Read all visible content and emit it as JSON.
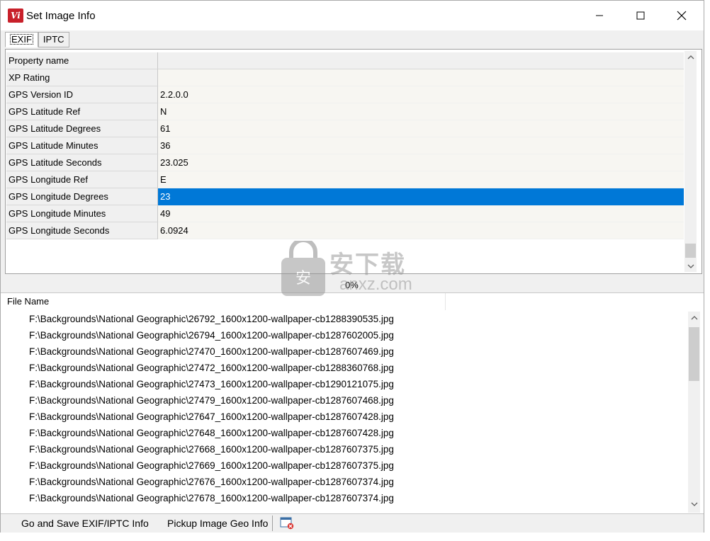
{
  "window": {
    "title": "Set Image Info",
    "app_icon_text": "Vi"
  },
  "tabs": [
    {
      "label": "EXIF",
      "active": true
    },
    {
      "label": "IPTC",
      "active": false
    }
  ],
  "grid": {
    "header": {
      "name": "Property name",
      "value": ""
    },
    "rows": [
      {
        "name": "XP Rating",
        "value": ""
      },
      {
        "name": "GPS Version ID",
        "value": "2.2.0.0"
      },
      {
        "name": "GPS Latitude Ref",
        "value": "N"
      },
      {
        "name": "GPS Latitude Degrees",
        "value": "61"
      },
      {
        "name": "GPS Latitude Minutes",
        "value": "36"
      },
      {
        "name": "GPS Latitude Seconds",
        "value": "23.025"
      },
      {
        "name": "GPS Longitude Ref",
        "value": "E"
      },
      {
        "name": "GPS Longitude Degrees",
        "value": "23"
      },
      {
        "name": "GPS Longitude Minutes",
        "value": "49"
      },
      {
        "name": "GPS Longitude Seconds",
        "value": "6.0924"
      }
    ],
    "selected_row": "GPS Longitude Degrees",
    "selection_color": "#0078d7"
  },
  "progress": {
    "text": "0%"
  },
  "file_list": {
    "header": "File Name",
    "items": [
      "F:\\Backgrounds\\National Geographic\\26792_1600x1200-wallpaper-cb1288390535.jpg",
      "F:\\Backgrounds\\National Geographic\\26794_1600x1200-wallpaper-cb1287602005.jpg",
      "F:\\Backgrounds\\National Geographic\\27470_1600x1200-wallpaper-cb1287607469.jpg",
      "F:\\Backgrounds\\National Geographic\\27472_1600x1200-wallpaper-cb1288360768.jpg",
      "F:\\Backgrounds\\National Geographic\\27473_1600x1200-wallpaper-cb1290121075.jpg",
      "F:\\Backgrounds\\National Geographic\\27479_1600x1200-wallpaper-cb1287607468.jpg",
      "F:\\Backgrounds\\National Geographic\\27647_1600x1200-wallpaper-cb1287607428.jpg",
      "F:\\Backgrounds\\National Geographic\\27648_1600x1200-wallpaper-cb1287607428.jpg",
      "F:\\Backgrounds\\National Geographic\\27668_1600x1200-wallpaper-cb1287607375.jpg",
      "F:\\Backgrounds\\National Geographic\\27669_1600x1200-wallpaper-cb1287607375.jpg",
      "F:\\Backgrounds\\National Geographic\\27676_1600x1200-wallpaper-cb1287607374.jpg",
      "F:\\Backgrounds\\National Geographic\\27678_1600x1200-wallpaper-cb1287607374.jpg"
    ]
  },
  "toolbar": {
    "go_save_label": "Go and Save EXIF/IPTC Info",
    "pickup_label": "Pickup Image Geo Info",
    "icon": "window-close-icon"
  },
  "watermark": {
    "text": "安下载",
    "sub": "anxz.com"
  }
}
